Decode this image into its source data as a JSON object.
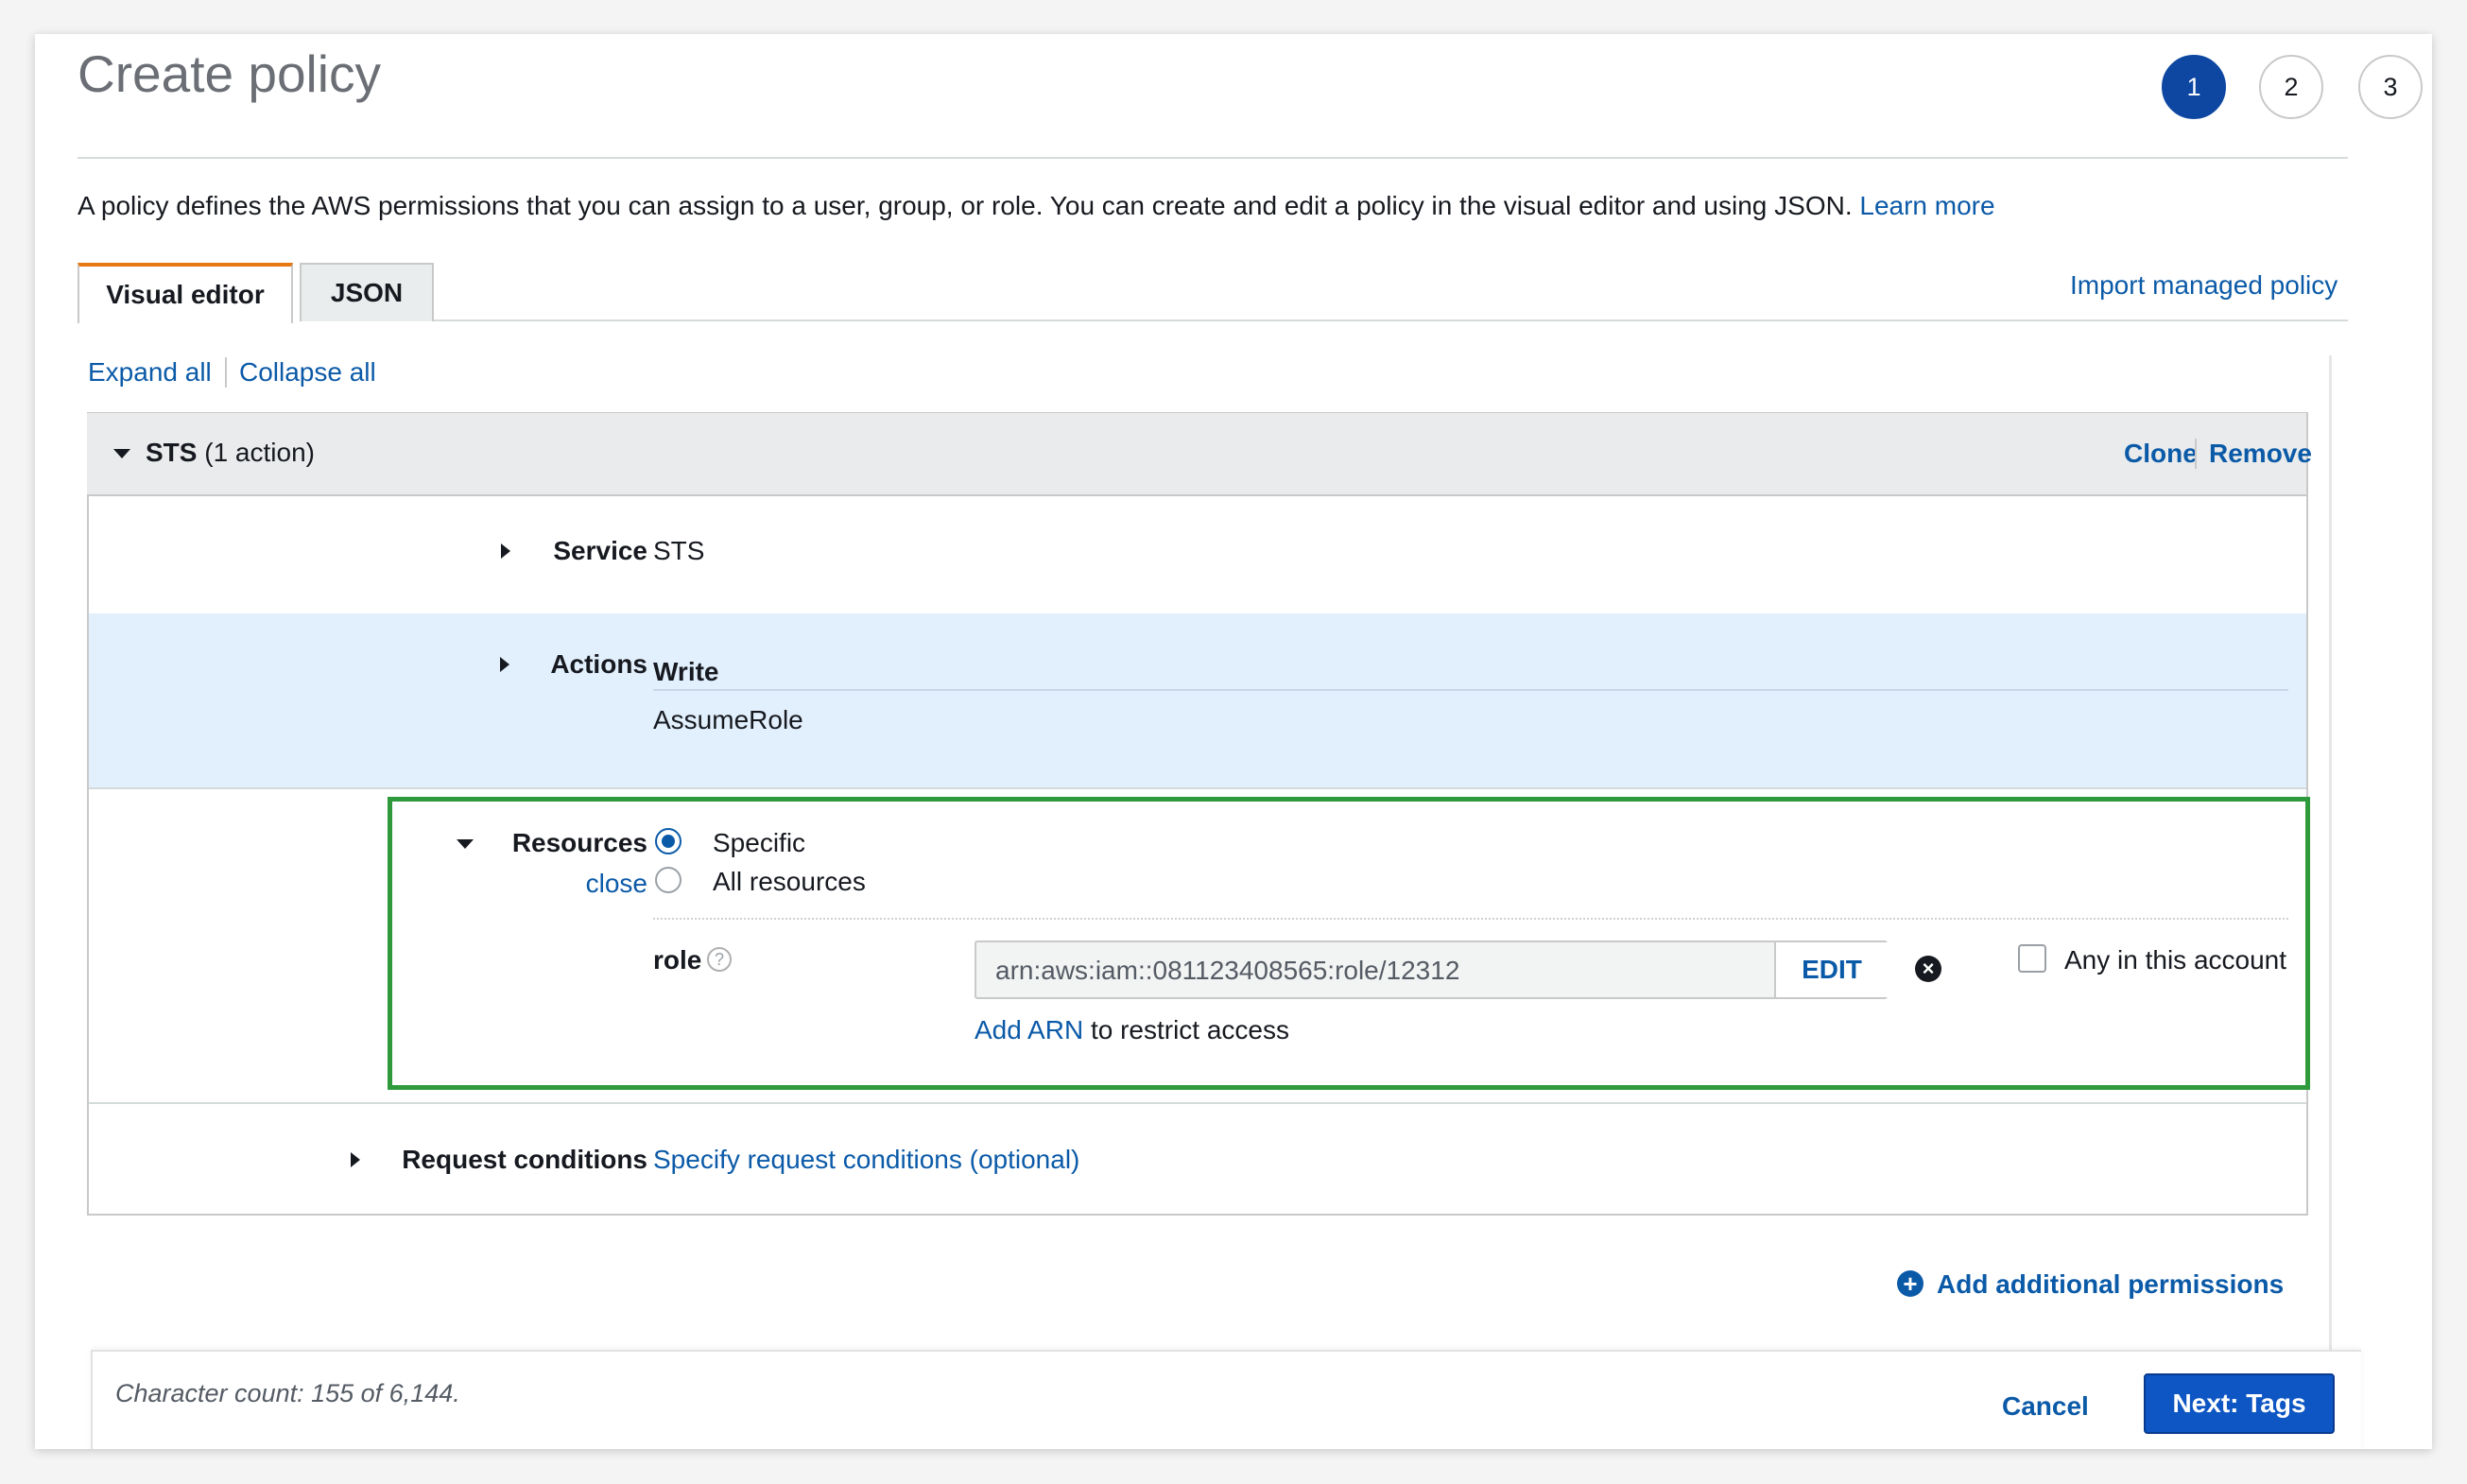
{
  "page": {
    "title": "Create policy",
    "steps": [
      "1",
      "2",
      "3"
    ],
    "description": "A policy defines the AWS permissions that you can assign to a user, group, or role. You can create and edit a policy in the visual editor and using JSON.",
    "learn_more": "Learn more"
  },
  "tabs": {
    "visual": "Visual editor",
    "json": "JSON"
  },
  "import_managed_policy": "Import managed policy",
  "controls": {
    "expand_all": "Expand all",
    "collapse_all": "Collapse all"
  },
  "permission": {
    "service_name": "STS",
    "action_count": "(1 action)",
    "clone": "Clone",
    "remove": "Remove",
    "service": {
      "label": "Service",
      "value": "STS"
    },
    "actions": {
      "label": "Actions",
      "group": "Write",
      "value": "AssumeRole"
    },
    "resources": {
      "label": "Resources",
      "close": "close",
      "option_specific": "Specific",
      "option_all": "All resources",
      "selected": "Specific",
      "role_label": "role",
      "arn_value": "arn:aws:iam::081123408565:role/12312",
      "edit": "EDIT",
      "any_in_account": "Any in this account",
      "add_arn": "Add ARN",
      "restrict_text": "to restrict access"
    },
    "request_conditions": {
      "label": "Request conditions",
      "link": "Specify request conditions (optional)"
    }
  },
  "add_permissions": "Add additional permissions",
  "footer": {
    "char_count": "Character count: 155 of 6,144.",
    "cancel": "Cancel",
    "next": "Next: Tags"
  },
  "colors": {
    "accent": "#0d47a1",
    "link": "#0b5aa8",
    "highlight_border": "#2e9a3b",
    "tab_active": "#e47911",
    "actions_bg": "#e2effc"
  }
}
